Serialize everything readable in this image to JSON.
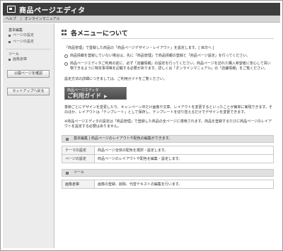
{
  "window": {
    "title": "商品ページエディタ"
  },
  "tabs": [
    "ヘルプ",
    "オンラインマニュアル"
  ],
  "sidebar": {
    "section_label": "基本編集",
    "items": [
      "ページの設定",
      "ページの設定"
    ],
    "tools_label": "ツール",
    "tool_items": [
      "画像倉庫"
    ],
    "publish_button": "公開ページを確認",
    "setup_button": "セットアップへ戻る"
  },
  "main": {
    "title": "各メニューについて",
    "intro": "「商品管理」で登録した商品の「商品ページデザイン・レイアウト」を設定します。[ 目次へ ]",
    "notes": [
      "商品情報を登録していない場合は、先に「商品管理」で商品情報の登録と「商品ページ設定」を行ってください。",
      "商品ページエディタご利用の前に、必ず「店舗情報」の設定を行ってください。商品ページを訪れた購入希望者に安心して買い物できるように特定事項等を記載する必要があります。詳しくは「オンラインマニュアル」の「店舗情報」をご覧ください。"
    ],
    "guide_text": "設定方法の詳細につきましては、ご利用ガイドをご覧ください。",
    "guide_button": {
      "line1": "商品ページエディタ",
      "line2": "ご利用ガイド"
    },
    "body": [
      "季節ごとにデザインを変更したり、キャンペーン中だけ画像や文章、レイアウトを変更するといったことが簡単に実現できます。そのほか、レイアウトは「テンプレート」として保存し、テンプレートを切り替えるだけでデザインを変更できます。",
      "※商品ページエディタの設定は「商品管理」で登録した商品の全ページに適用されます。商品を登録するたびに商品ページのレイアウトを設定する必要はありません。"
    ],
    "edit_section": {
      "heading": "基本編集 | 商品ページのレイアウトや配色の編集ができます。",
      "rows": [
        {
          "key": "テーマの設定",
          "value": "商品ページ全体の配色を選択・設定します。"
        },
        {
          "key": "ページの設定",
          "value": "商品ページのレイアウトや配色を編集・設定します。"
        }
      ]
    },
    "tool_section": {
      "heading": "ツール",
      "rows": [
        {
          "key": "画像倉庫",
          "value": "画像の登録、削除、代替テキストの編集を行います。"
        }
      ]
    }
  }
}
